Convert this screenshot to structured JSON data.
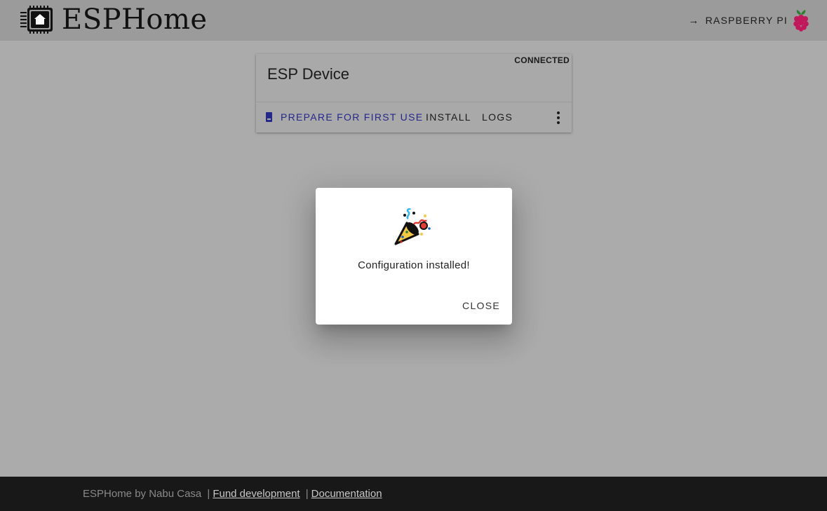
{
  "header": {
    "app_title": "ESPHome",
    "logo_icon": "esphome-chip-icon",
    "link_label": "RASPBERRY PI",
    "link_arrow_icon": "arrow-right-icon",
    "link_logo_icon": "raspberry-pi-icon"
  },
  "device_card": {
    "status": "CONNECTED",
    "title": "ESP Device",
    "actions": {
      "prepare": "PREPARE FOR FIRST USE",
      "install": "INSTALL",
      "logs": "LOGS"
    },
    "prepare_icon": "device-install-icon",
    "menu_icon": "more-vertical-icon",
    "accent_color": "#23288a"
  },
  "dialog": {
    "icon": "party-popper-icon",
    "message": "Configuration installed!",
    "close_label": "CLOSE"
  },
  "footer": {
    "prefix": "ESPHome by Nabu Casa",
    "separator": "|",
    "link_fund": "Fund development",
    "link_docs": "Documentation"
  }
}
